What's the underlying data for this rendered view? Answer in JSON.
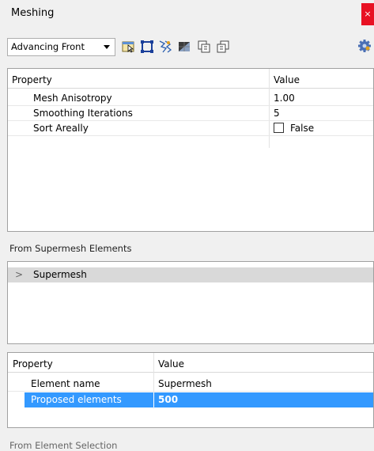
{
  "window": {
    "title": "Meshing",
    "close_label": "×"
  },
  "toolbar": {
    "method": "Advancing Front",
    "tools": [
      "select-elements-icon",
      "boundary-icon",
      "mesh-spark-icon",
      "mesh-gradient-icon",
      "copy-mesh-icon",
      "paste-mesh-icon"
    ],
    "settings_icon": "gear-icon"
  },
  "properties_grid": {
    "headers": {
      "property": "Property",
      "value": "Value"
    },
    "rows": [
      {
        "property": "Mesh Anisotropy",
        "value": "1.00"
      },
      {
        "property": "Smoothing Iterations",
        "value": "5"
      },
      {
        "property": "Sort Areally",
        "value": "False",
        "checked": false
      }
    ]
  },
  "supermesh_section": {
    "label": "From Supermesh Elements",
    "tree": [
      {
        "label": "Supermesh",
        "expanded": false
      }
    ]
  },
  "element_grid": {
    "headers": {
      "property": "Property",
      "value": "Value"
    },
    "rows": [
      {
        "property": "Element name",
        "value": "Supermesh",
        "selected": false
      },
      {
        "property": "Proposed elements",
        "value": "500",
        "selected": true
      }
    ]
  },
  "selection_section": {
    "label": "From Element Selection"
  },
  "colors": {
    "selection": "#3399ff",
    "close": "#e81123",
    "tree_row": "#d9d9d9"
  }
}
